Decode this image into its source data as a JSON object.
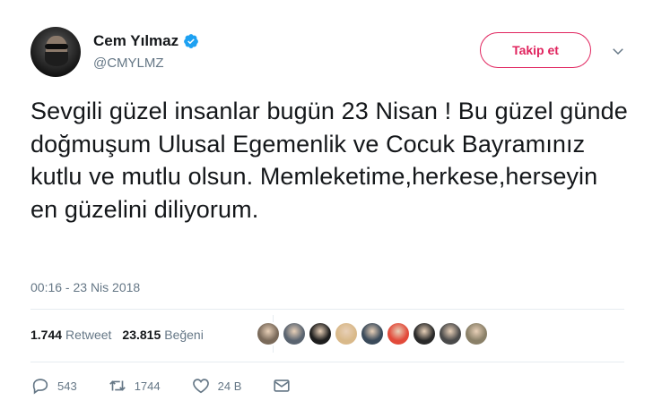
{
  "user": {
    "display_name": "Cem Yılmaz",
    "handle": "@CMYLMZ",
    "avatar_icon": "avatar-photo",
    "verified_icon": "verified-badge-icon"
  },
  "follow_button": {
    "label": "Takip et",
    "color": "#e0245e"
  },
  "menu": {
    "icon": "chevron-down-icon"
  },
  "tweet": {
    "text": "Sevgili güzel insanlar bugün 23 Nisan ! Bu güzel günde doğmuşum Ulusal Egemenlik ve Cocuk Bayramınız kutlu ve mutlu olsun. Memleketime,herkese,herseyin en güzelini diliyorum.",
    "timestamp": "00:16 - 23 Nis 2018"
  },
  "stats": {
    "retweets_count": "1.744",
    "retweets_label": "Retweet",
    "likes_count": "23.815",
    "likes_label": "Beğeni"
  },
  "likers": [
    {
      "color": "#7a6a5a"
    },
    {
      "color": "#5a6470"
    },
    {
      "color": "#1e1e1e"
    },
    {
      "color": "#d9b98a"
    },
    {
      "color": "#3a4a5a"
    },
    {
      "color": "#e24a3a"
    },
    {
      "color": "#2a2a2a"
    },
    {
      "color": "#4a4a4a"
    },
    {
      "color": "#8a8068"
    }
  ],
  "actions": {
    "reply_count": "543",
    "retweet_count": "1744",
    "like_count": "24 B",
    "icon_color": "#657786"
  }
}
